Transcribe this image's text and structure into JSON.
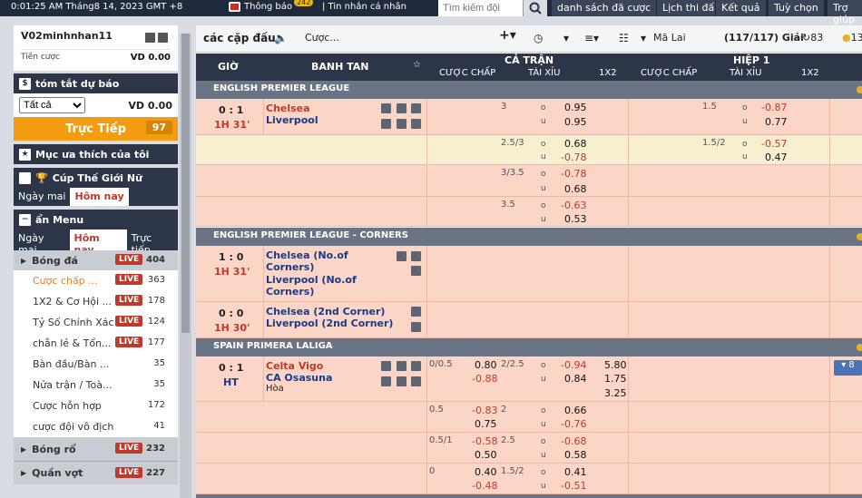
{
  "topbar": {
    "datetime": "0:01:25 AM Tháng8 14, 2023 GMT +8",
    "notice_label": "Thông báo",
    "notice_count": "242",
    "messages": "| Tin nhắn cá nhân",
    "search_placeholder": "Tìm kiếm đội",
    "nav": [
      "danh sách đã cược",
      "Lịch thi đấu",
      "Kết quả",
      "Tuỳ chọn",
      "Trợ giúp"
    ]
  },
  "account": {
    "username": "V02minhnhan11",
    "balance_label": "Tiền cược",
    "balance_value": "VD 0.00"
  },
  "bet_summary": {
    "title": "tóm tắt dự báo",
    "filter": "Tất cả",
    "value": "VD 0.00"
  },
  "live_button": {
    "label": "Trực Tiếp",
    "count": "97"
  },
  "favorites": {
    "title": "Mục ưa thích của tôi"
  },
  "womens_cup": {
    "title": "Cúp Thế Giới Nữ",
    "tabs": [
      "Ngày mai",
      "Hôm nay"
    ]
  },
  "menu": {
    "title": "ẩn Menu",
    "tabs": [
      "Ngày mai",
      "Hôm nay",
      "Trực tiếp"
    ],
    "live_badge": "LIVE",
    "sports": [
      {
        "name": "Bóng đá",
        "count": "404"
      }
    ],
    "subs": [
      {
        "name": "Cược chấp ...",
        "count": "363",
        "live": true
      },
      {
        "name": "1X2 & Cơ Hội ...",
        "count": "178",
        "live": true
      },
      {
        "name": "Tỷ Số Chính Xác",
        "count": "124",
        "live": true
      },
      {
        "name": "chẵn lẻ & Tổn...",
        "count": "177",
        "live": true
      },
      {
        "name": "Bàn đầu/Bàn ...",
        "count": "35",
        "live": false
      },
      {
        "name": "Nửa trận / Toà...",
        "count": "35",
        "live": false
      },
      {
        "name": "Cược hỗn hợp",
        "count": "172",
        "live": false
      },
      {
        "name": "cược đội vô địch",
        "count": "41",
        "live": false
      }
    ],
    "more_sports": [
      {
        "name": "Bóng rổ",
        "count": "232"
      },
      {
        "name": "Quần vợt",
        "count": "227"
      }
    ]
  },
  "toolbar": {
    "title": "các cặp đấu",
    "bet_label": "Cược...",
    "odds_type": "Mã Lai",
    "leagues": "(117/117) Giải",
    "count_a": "83",
    "count_b": "13"
  },
  "table_header": {
    "time": "GIỜ",
    "match": "BANH TAN",
    "full": "CẢ TRẬN",
    "half": "HIỆP 1",
    "hdp": "CƯỢC CHẤP",
    "ou": "TÀI XỈU",
    "x12": "1X2"
  },
  "leagues": [
    {
      "name": "ENGLISH PREMIER LEAGUE"
    },
    {
      "name": "ENGLISH PREMIER LEAGUE - CORNERS"
    },
    {
      "name": "SPAIN PRIMERA LALIGA"
    }
  ],
  "matches": [
    {
      "score": "0 : 1",
      "time": "1H 31'",
      "home": "Chelsea",
      "away": "Liverpool"
    },
    {
      "score": "1 : 0",
      "time": "1H 31'",
      "home": "Chelsea (No.of Corners)",
      "away": "Liverpool (No.of Corners)"
    },
    {
      "score": "0 : 0",
      "time": "1H 30'",
      "home": "Chelsea (2nd Corner)",
      "away": "Liverpool (2nd Corner)"
    },
    {
      "score": "0 : 1",
      "time": "HT",
      "home": "Celta Vigo",
      "away": "CA Osasuna",
      "draw": "Hòa",
      "more": "8"
    }
  ],
  "odds": {
    "epl": [
      {
        "ou_line": "3",
        "o": "0.95",
        "u": "0.95",
        "h1_line": "1.5",
        "h1_o": "-0.87",
        "h1_u": "0.77"
      },
      {
        "ou_line": "2.5/3",
        "o": "0.68",
        "u": "-0.78",
        "h1_line": "1.5/2",
        "h1_o": "-0.57",
        "h1_u": "0.47"
      },
      {
        "ou_line": "3/3.5",
        "o": "-0.78",
        "u": "0.68"
      },
      {
        "ou_line": "3.5",
        "o": "-0.63",
        "u": "0.53"
      }
    ],
    "laliga": [
      {
        "hdp": "0/0.5",
        "hdp_h": "0.80",
        "hdp_a": "-0.88",
        "ou_line": "2/2.5",
        "o": "-0.94",
        "u": "0.84",
        "x1": "5.80",
        "x2": "1.75",
        "xx": "3.25"
      },
      {
        "hdp": "0.5",
        "hdp_h": "-0.83",
        "hdp_a": "0.75",
        "ou_line": "2",
        "o": "0.66",
        "u": "-0.76"
      },
      {
        "hdp": "0.5/1",
        "hdp_h": "-0.58",
        "hdp_a": "0.50",
        "ou_line": "2.5",
        "o": "-0.68",
        "u": "0.58"
      },
      {
        "hdp": "0",
        "hdp_h": "0.40",
        "hdp_a": "-0.48",
        "ou_line": "1.5/2",
        "o": "0.41",
        "u": "-0.51"
      }
    ],
    "o_letter": "o",
    "u_letter": "u"
  }
}
